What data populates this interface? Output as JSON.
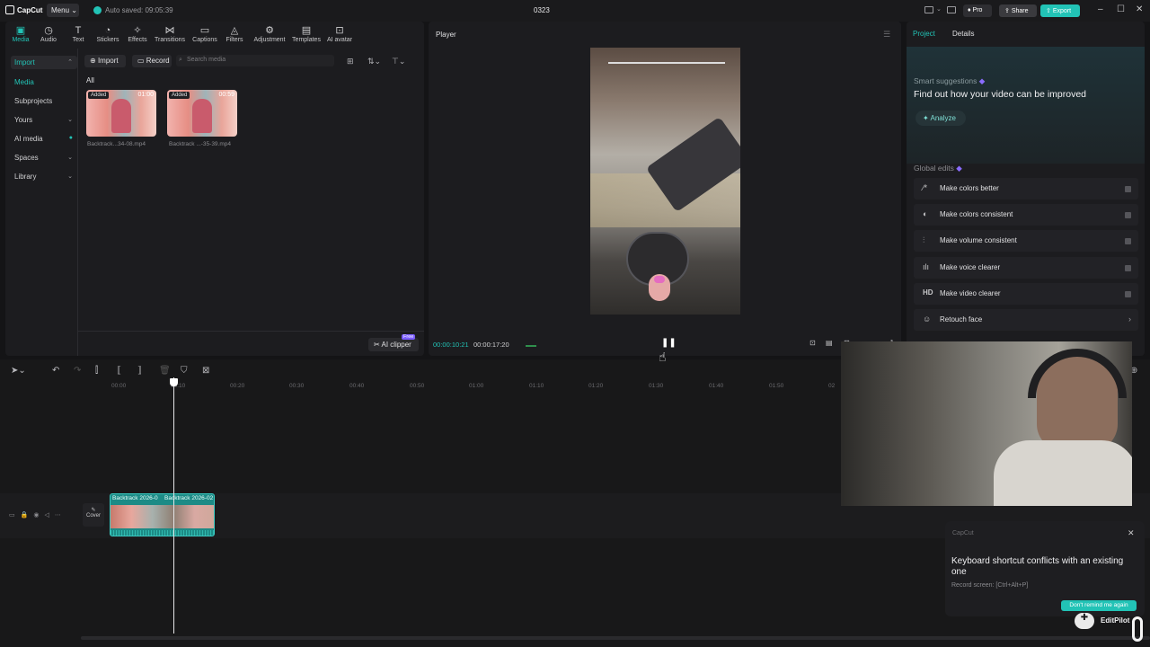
{
  "titlebar": {
    "app_name": "CapCut",
    "menu_label": "Menu",
    "autosave": "Auto saved: 09:05:39",
    "project_title": "0323",
    "pro_label": "Pro",
    "share_label": "Share",
    "export_label": "Export"
  },
  "toolbar": {
    "tabs": [
      {
        "label": "Media",
        "icon": "media-icon"
      },
      {
        "label": "Audio",
        "icon": "audio-icon"
      },
      {
        "label": "Text",
        "icon": "text-icon"
      },
      {
        "label": "Stickers",
        "icon": "stickers-icon"
      },
      {
        "label": "Effects",
        "icon": "effects-icon"
      },
      {
        "label": "Transitions",
        "icon": "transitions-icon"
      },
      {
        "label": "Captions",
        "icon": "captions-icon"
      },
      {
        "label": "Filters",
        "icon": "filters-icon"
      },
      {
        "label": "Adjustment",
        "icon": "adjustment-icon"
      },
      {
        "label": "Templates",
        "icon": "templates-icon"
      },
      {
        "label": "AI avatar",
        "icon": "ai-avatar-icon"
      }
    ]
  },
  "sidebar": {
    "import": "Import",
    "media": "Media",
    "subprojects": "Subprojects",
    "yours": "Yours",
    "ai_media": "AI media",
    "spaces": "Spaces",
    "library": "Library"
  },
  "media": {
    "import_button": "Import",
    "record_button": "Record",
    "search_placeholder": "Search media",
    "filter_all": "All",
    "clips": [
      {
        "badge": "Added",
        "duration": "01:00",
        "name": "Backtrack...34-08.mp4"
      },
      {
        "badge": "Added",
        "duration": "00:59",
        "name": "Backtrack ...-35-39.mp4"
      }
    ],
    "ai_clipper": "AI clipper",
    "free_badge": "Free"
  },
  "player": {
    "title": "Player",
    "current_time": "00:00:10:21",
    "total_time": "00:00:17:20"
  },
  "properties": {
    "tab_project": "Project",
    "tab_details": "Details",
    "smart_title": "Smart suggestions",
    "smart_subtitle": "Find out how your video can be improved",
    "analyze_button": "Analyze",
    "global_edits": "Global edits",
    "options": [
      {
        "label": "Make colors better",
        "icon": "magic-wand-icon",
        "has_toggle": true
      },
      {
        "label": "Make colors consistent",
        "icon": "color-drop-icon",
        "has_toggle": true
      },
      {
        "label": "Make volume consistent",
        "icon": "sliders-icon",
        "has_toggle": true
      },
      {
        "label": "Make voice clearer",
        "icon": "voice-wave-icon",
        "has_toggle": true
      },
      {
        "label": "Make video clearer",
        "icon": "hd-icon",
        "has_toggle": true
      },
      {
        "label": "Retouch face",
        "icon": "face-icon",
        "has_toggle": false
      }
    ]
  },
  "timeline": {
    "ticks": [
      "00:00",
      "00:10",
      "00:20",
      "00:30",
      "00:40",
      "00:50",
      "01:00",
      "01:10",
      "01:20",
      "01:30",
      "01:40",
      "01:50",
      "02"
    ],
    "cover_label": "Cover",
    "clip_labels": [
      "Backtrack 2026-0",
      "Backtrack 2026-02"
    ]
  },
  "toast": {
    "app": "CapCut",
    "title": "Keyboard shortcut conflicts with an existing one",
    "detail": "Record screen: [Ctrl+Alt+P]",
    "button": "Don't remind me again",
    "editpilot": "EditPilot"
  }
}
